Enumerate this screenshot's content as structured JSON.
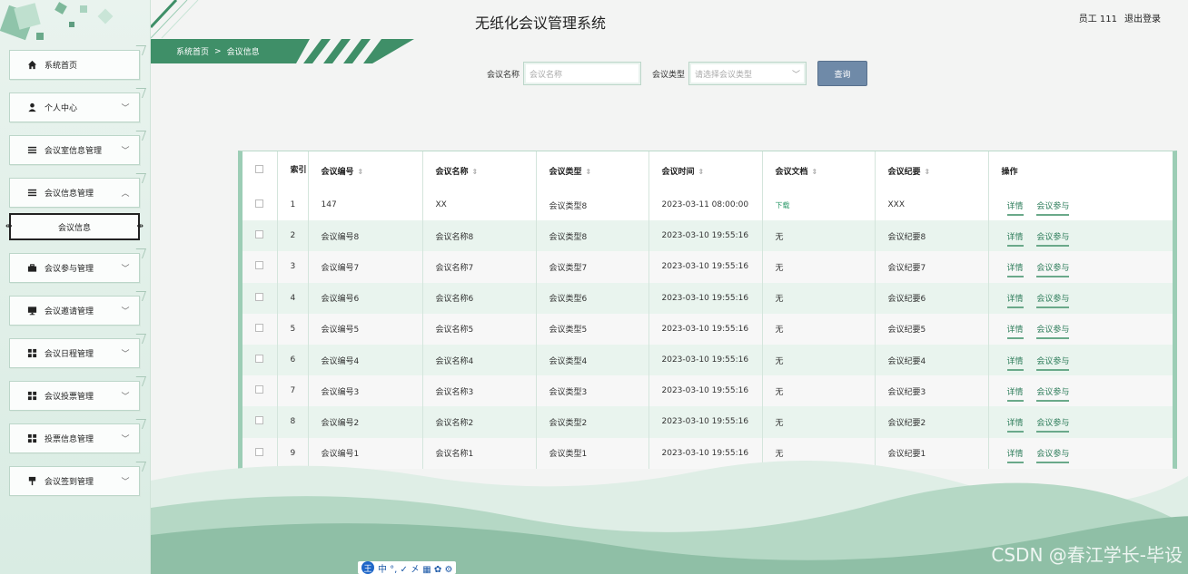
{
  "app": {
    "title": "无纸化会议管理系统",
    "user_label": "员工 111",
    "logout_label": "退出登录"
  },
  "breadcrumb": {
    "home": "系统首页",
    "separator": ">",
    "current": "会议信息"
  },
  "sidebar": {
    "items": [
      {
        "label": "系统首页",
        "icon": "home-icon",
        "expandable": false
      },
      {
        "label": "个人中心",
        "icon": "user-icon",
        "expandable": true
      },
      {
        "label": "会议室信息管理",
        "icon": "list-icon",
        "expandable": true
      },
      {
        "label": "会议信息管理",
        "icon": "list-icon",
        "expandable": true,
        "expanded": true
      },
      {
        "label": "会议参与管理",
        "icon": "briefcase-icon",
        "expandable": true
      },
      {
        "label": "会议邀请管理",
        "icon": "monitor-icon",
        "expandable": true
      },
      {
        "label": "会议日程管理",
        "icon": "grid-icon",
        "expandable": true
      },
      {
        "label": "会议投票管理",
        "icon": "grid-icon",
        "expandable": true
      },
      {
        "label": "投票信息管理",
        "icon": "grid-icon",
        "expandable": true
      },
      {
        "label": "会议签到管理",
        "icon": "pin-icon",
        "expandable": true
      }
    ],
    "sub_item": {
      "label": "会议信息"
    }
  },
  "search": {
    "name_label": "会议名称",
    "name_placeholder": "会议名称",
    "type_label": "会议类型",
    "type_placeholder": "请选择会议类型",
    "query_button": "查询"
  },
  "table": {
    "headers": {
      "index": "索引",
      "code": "会议编号",
      "name": "会议名称",
      "type": "会议类型",
      "time": "会议时间",
      "doc": "会议文档",
      "minutes": "会议纪要",
      "ops": "操作"
    },
    "rows": [
      {
        "idx": "1",
        "code": "147",
        "name": "XX",
        "type": "会议类型8",
        "time": "2023-03-11 08:00:00",
        "doc": "下载",
        "minutes": "XXX"
      },
      {
        "idx": "2",
        "code": "会议编号8",
        "name": "会议名称8",
        "type": "会议类型8",
        "time": "2023-03-10 19:55:16",
        "doc": "无",
        "minutes": "会议纪要8"
      },
      {
        "idx": "3",
        "code": "会议编号7",
        "name": "会议名称7",
        "type": "会议类型7",
        "time": "2023-03-10 19:55:16",
        "doc": "无",
        "minutes": "会议纪要7"
      },
      {
        "idx": "4",
        "code": "会议编号6",
        "name": "会议名称6",
        "type": "会议类型6",
        "time": "2023-03-10 19:55:16",
        "doc": "无",
        "minutes": "会议纪要6"
      },
      {
        "idx": "5",
        "code": "会议编号5",
        "name": "会议名称5",
        "type": "会议类型5",
        "time": "2023-03-10 19:55:16",
        "doc": "无",
        "minutes": "会议纪要5"
      },
      {
        "idx": "6",
        "code": "会议编号4",
        "name": "会议名称4",
        "type": "会议类型4",
        "time": "2023-03-10 19:55:16",
        "doc": "无",
        "minutes": "会议纪要4"
      },
      {
        "idx": "7",
        "code": "会议编号3",
        "name": "会议名称3",
        "type": "会议类型3",
        "time": "2023-03-10 19:55:16",
        "doc": "无",
        "minutes": "会议纪要3"
      },
      {
        "idx": "8",
        "code": "会议编号2",
        "name": "会议名称2",
        "type": "会议类型2",
        "time": "2023-03-10 19:55:16",
        "doc": "无",
        "minutes": "会议纪要2"
      },
      {
        "idx": "9",
        "code": "会议编号1",
        "name": "会议名称1",
        "type": "会议类型1",
        "time": "2023-03-10 19:55:16",
        "doc": "无",
        "minutes": "会议纪要1"
      }
    ],
    "op_detail": "详情",
    "op_join": "会议参与"
  },
  "watermark": "CSDN @春江学长-毕设",
  "ime_bar": {
    "logo": "王",
    "tools": "中 °, ✓ 㐅 ▦ ✿ ⚙"
  },
  "colors": {
    "accent_green": "#3f8f68",
    "query_button": "#6f8aa8",
    "sidebar_bg": "#e9f3ee"
  }
}
